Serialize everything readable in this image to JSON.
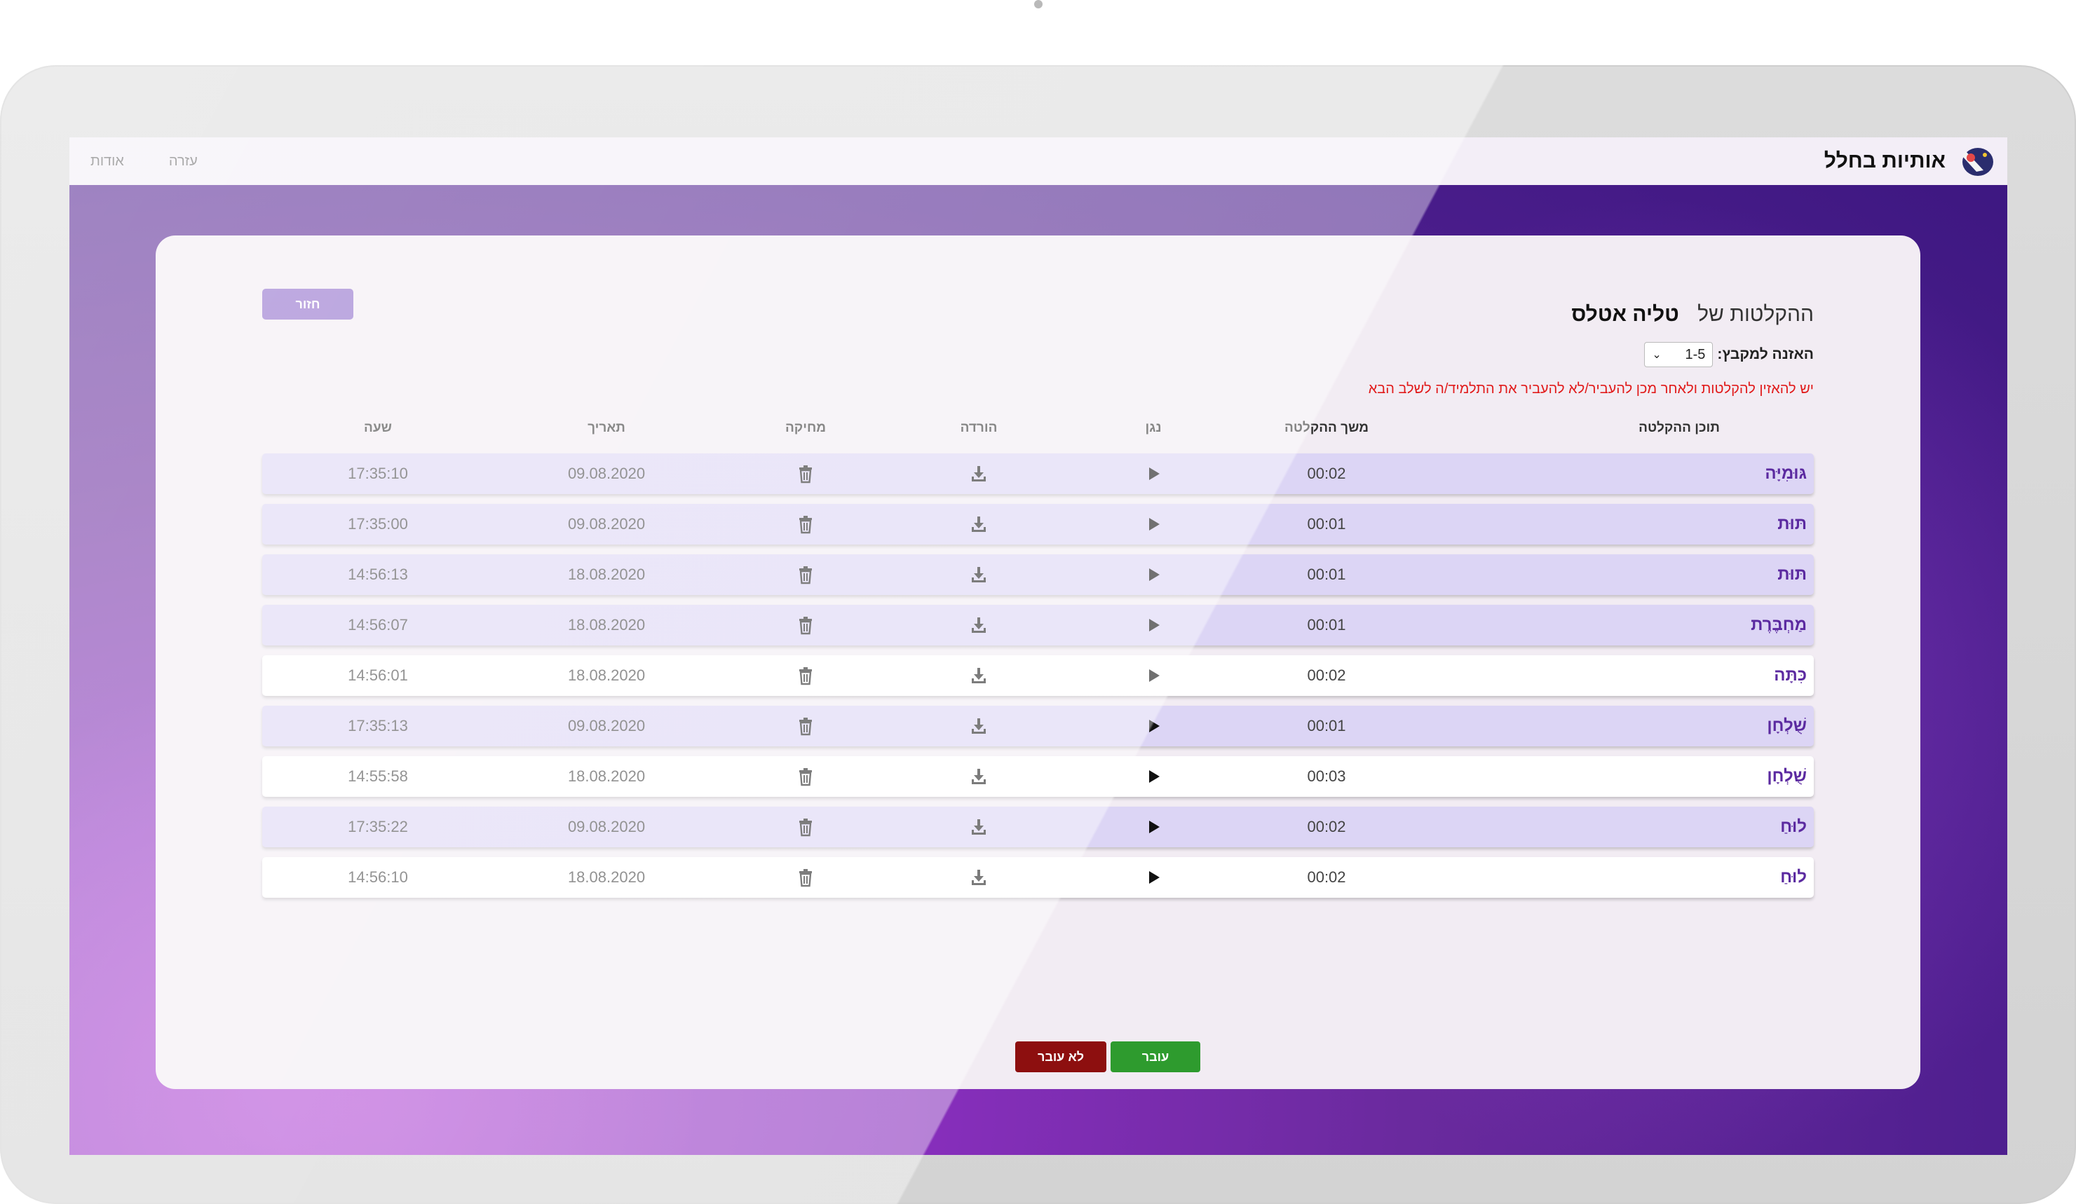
{
  "nav": {
    "brand": "אותיות בחלל",
    "links": [
      "עזרה",
      "אודות"
    ]
  },
  "page": {
    "back_label": "חזור",
    "title_prefix": "ההקלטות של",
    "student_name": "טליה אטלס",
    "listen_label": "האזנה למקבץ:",
    "listen_value": "1-5",
    "warning": "יש להאזין להקלטות ולאחר מכן להעביר/לא להעביר את התלמיד/ה לשלב הבא",
    "pass_label": "עובר",
    "fail_label": "לא עובר"
  },
  "table": {
    "headers": {
      "content": "תוכן ההקלטה",
      "duration": "משך ההקלטה",
      "player": "נגן",
      "download": "הורדה",
      "delete": "מחיקה",
      "date": "תאריך",
      "time": "שעה"
    },
    "rows": [
      {
        "word": "גּוּמִיָּה",
        "duration": "00:02",
        "date": "09.08.2020",
        "time": "17:35:10",
        "style": "lav"
      },
      {
        "word": "תּוּת",
        "duration": "00:01",
        "date": "09.08.2020",
        "time": "17:35:00",
        "style": "lav"
      },
      {
        "word": "תּוּת",
        "duration": "00:01",
        "date": "18.08.2020",
        "time": "14:56:13",
        "style": "lav"
      },
      {
        "word": "מַחְבֶּרֶת",
        "duration": "00:01",
        "date": "18.08.2020",
        "time": "14:56:07",
        "style": "lav"
      },
      {
        "word": "כִּתָּה",
        "duration": "00:02",
        "date": "18.08.2020",
        "time": "14:56:01",
        "style": "white"
      },
      {
        "word": "שֻׁלְחָן",
        "duration": "00:01",
        "date": "09.08.2020",
        "time": "17:35:13",
        "style": "lav"
      },
      {
        "word": "שֻׁלְחָן",
        "duration": "00:03",
        "date": "18.08.2020",
        "time": "14:55:58",
        "style": "white"
      },
      {
        "word": "לוּחַ",
        "duration": "00:02",
        "date": "09.08.2020",
        "time": "17:35:22",
        "style": "lav"
      },
      {
        "word": "לוּחַ",
        "duration": "00:02",
        "date": "18.08.2020",
        "time": "14:56:10",
        "style": "white"
      }
    ]
  },
  "colors": {
    "accent": "#8b67c9",
    "row_highlight": "#dcd5f5",
    "pass": "#2e9b2e",
    "fail": "#8d0f0f",
    "warning": "#e11a1a",
    "word": "#5b2aa0"
  },
  "icons": [
    "play-icon",
    "download-icon",
    "trash-icon",
    "chevron-down-icon",
    "logo-icon"
  ]
}
